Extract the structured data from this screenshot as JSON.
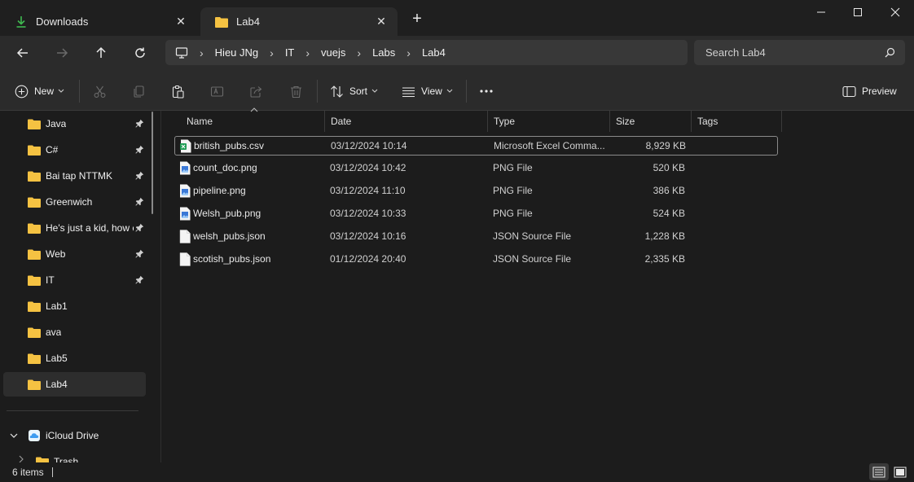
{
  "tabs": [
    {
      "label": "Downloads",
      "icon": "download-icon",
      "active": false
    },
    {
      "label": "Lab4",
      "icon": "folder-icon",
      "active": true
    }
  ],
  "window_controls": [
    "minimize-icon",
    "maximize-icon",
    "close-icon"
  ],
  "breadcrumb": [
    "Hieu JNg",
    "IT",
    "vuejs",
    "Labs",
    "Lab4"
  ],
  "search": {
    "placeholder": "Search Lab4"
  },
  "toolbar": {
    "new_label": "New",
    "sort_label": "Sort",
    "view_label": "View",
    "preview_label": "Preview"
  },
  "sidebar": {
    "items": [
      {
        "label": "Java",
        "pinned": true
      },
      {
        "label": "C#",
        "pinned": true
      },
      {
        "label": "Bai tap NTTMK",
        "pinned": true
      },
      {
        "label": "Greenwich",
        "pinned": true
      },
      {
        "label": "He's just a kid, how c",
        "pinned": true
      },
      {
        "label": "Web",
        "pinned": true
      },
      {
        "label": "IT",
        "pinned": true
      },
      {
        "label": "Lab1",
        "pinned": false
      },
      {
        "label": "ava",
        "pinned": false
      },
      {
        "label": "Lab5",
        "pinned": false
      },
      {
        "label": "Lab4",
        "pinned": false,
        "selected": true
      }
    ],
    "cloud": {
      "label": "iCloud Drive"
    },
    "trash": {
      "label": "Trash"
    }
  },
  "columns": [
    "Name",
    "Date",
    "Type",
    "Size",
    "Tags"
  ],
  "files": [
    {
      "name": "british_pubs.csv",
      "date": "03/12/2024 10:14",
      "type": "Microsoft Excel Comma...",
      "size": "8,929 KB",
      "icon": "excel-icon"
    },
    {
      "name": "count_doc.png",
      "date": "03/12/2024 10:42",
      "type": "PNG File",
      "size": "520 KB",
      "icon": "image-icon"
    },
    {
      "name": "pipeline.png",
      "date": "03/12/2024 11:10",
      "type": "PNG File",
      "size": "386 KB",
      "icon": "image-icon"
    },
    {
      "name": "Welsh_pub.png",
      "date": "03/12/2024 10:33",
      "type": "PNG File",
      "size": "524 KB",
      "icon": "image-icon"
    },
    {
      "name": "welsh_pubs.json",
      "date": "03/12/2024 10:16",
      "type": "JSON Source File",
      "size": "1,228 KB",
      "icon": "json-file-icon"
    },
    {
      "name": "scotish_pubs.json",
      "date": "01/12/2024 20:40",
      "type": "JSON Source File",
      "size": "2,335 KB",
      "icon": "json-file-icon"
    }
  ],
  "status": {
    "item_count": "6 items"
  },
  "colors": {
    "folder": "#f5c242",
    "accent": "#4cc2ff",
    "excel": "#1f9d55",
    "png": "#3a78d6"
  }
}
